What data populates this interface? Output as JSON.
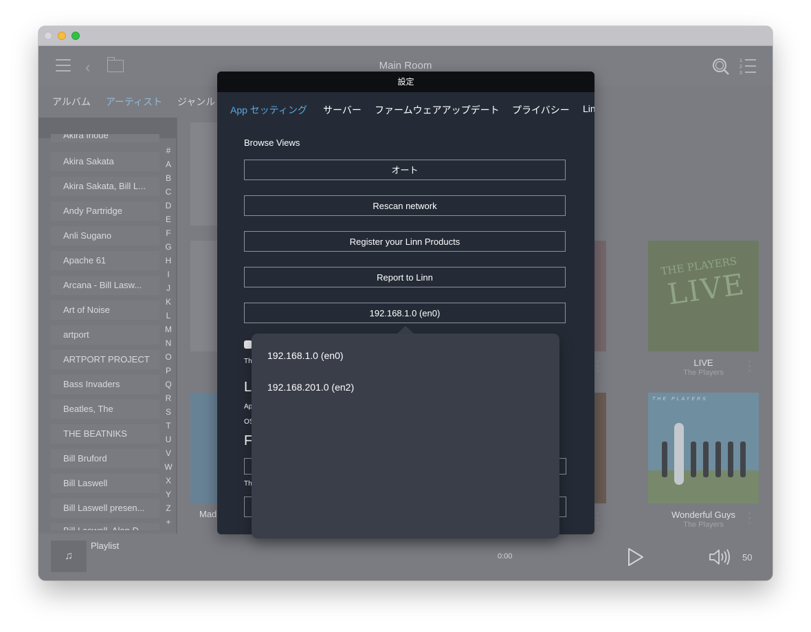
{
  "window": {
    "room_title": "Main Room"
  },
  "categories": [
    "アルバム",
    "アーティスト",
    "ジャンル"
  ],
  "active_category": "アーティスト",
  "artists": [
    "Akira Inoue",
    "Akira Sakata",
    "Akira Sakata, Bill L...",
    "Andy Partridge",
    "Anli Sugano",
    "Apache 61",
    "Arcana - Bill Lasw...",
    "Art of Noise",
    "artport",
    "ARTPORT PROJECT",
    "Bass Invaders",
    "Beatles, The",
    "THE BEATNIKS",
    "Bill Bruford",
    "Bill Laswell",
    "Bill Laswell presen...",
    "Bill Laswell, Alan D..."
  ],
  "index_letters": [
    "#",
    "A",
    "B",
    "C",
    "D",
    "E",
    "F",
    "G",
    "H",
    "I",
    "J",
    "K",
    "L",
    "M",
    "N",
    "O",
    "P",
    "Q",
    "R",
    "S",
    "T",
    "U",
    "V",
    "W",
    "X",
    "Y",
    "Z",
    "+"
  ],
  "albums": [
    {
      "title": "LIVE",
      "artist": "The Players",
      "cover_text": "LIVE",
      "cover_sub": "THE PLAYERS"
    },
    {
      "title": "Wonderful Guys",
      "artist": "The Players",
      "cover_band": "THE PLAYERS"
    }
  ],
  "partial_album_label": "Mad",
  "player": {
    "queue_label": "Playlist",
    "time": "0:00",
    "volume": "50"
  },
  "settings": {
    "title": "設定",
    "tabs": [
      "App セッティング",
      "サーバー",
      "ファームウェアアップデート",
      "プライバシー",
      "Lin"
    ],
    "active_tab": "App セッティング",
    "section_label": "Browse Views",
    "buttons": {
      "auto": "オート",
      "rescan": "Rescan network",
      "register": "Register your Linn Products",
      "report": "Report to Linn",
      "network": "192.168.1.0 (en0)"
    },
    "obscured": {
      "th1": "Th",
      "heading_l": "L",
      "ap": "Ap",
      "os": "OS",
      "heading_f": "F",
      "th2": "Th"
    }
  },
  "network_popover": {
    "options": [
      "192.168.1.0 (en0)",
      "192.168.201.0 (en2)"
    ]
  }
}
